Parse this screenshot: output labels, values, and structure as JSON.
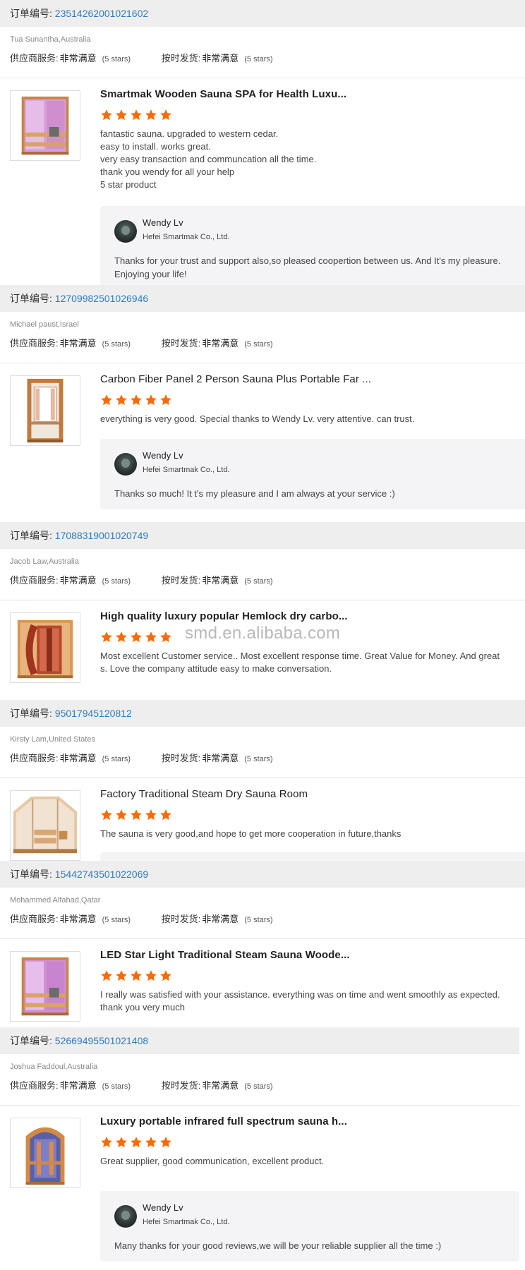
{
  "labels": {
    "order_no": "订单编号:",
    "supplier_service": "供应商服务:",
    "on_time_delivery": "按时发货:",
    "rating_value": "非常满意",
    "rating_stars": "(5 stars)"
  },
  "star_color": "#ff6a00",
  "link_color": "#2e7cc0",
  "orders": [
    {
      "order_number": "23514262001021602",
      "buyer": "Tua Sunantha,Australia",
      "product_title": "Smartmak Wooden Sauna SPA for Health Luxu...",
      "rating": 5,
      "review_lines": [
        "fantastic sauna. upgraded to western cedar.",
        "easy to install. works great.",
        "very easy transaction and communcation all the time.",
        "thank you wendy for all your help",
        "5 star product"
      ],
      "reply": {
        "name": "Wendy Lv",
        "company": "Hefei Smartmak Co., Ltd.",
        "lines": [
          "Thanks for your trust and support also,so pleased coopertion between us. And It's my pleasure.",
          "Enjoying your life!"
        ]
      }
    },
    {
      "order_number": "12709982501026946",
      "buyer": "Michael paust,Israel",
      "product_title": "Carbon Fiber Panel 2 Person Sauna Plus Portable Far ...",
      "rating": 5,
      "review_lines": [
        "everything is very good.  Special thanks to Wendy Lv.  very attentive.  can trust."
      ],
      "reply": {
        "name": "Wendy Lv",
        "company": "Hefei Smartmak Co., Ltd.",
        "lines": [
          "Thanks so much! It t's my pleasure and I am always at your service :)"
        ]
      }
    },
    {
      "order_number": "17088319001020749",
      "buyer": "Jacob Law,Australia",
      "product_title": "High quality luxury popular Hemlock dry carbo...",
      "rating": 5,
      "review_lines": [
        "Most excellent Customer service.. Most excellent response time. Great Value for Money. And great",
        "s. Love the company attitude easy to make conversation."
      ]
    },
    {
      "order_number": "95017945120812",
      "buyer": "Kirsty Lam,United States",
      "product_title": "Factory Traditional Steam Dry Sauna Room",
      "rating": 5,
      "review_lines": [
        "The sauna is very good,and hope to get more cooperation in future,thanks"
      ]
    },
    {
      "order_number": "15442743501022069",
      "buyer": "Mohammed Alfahad,Qatar",
      "product_title": "LED Star Light Traditional Steam Sauna Woode...",
      "rating": 5,
      "review_lines": [
        "I really was satisfied with your assistance. everything was on time and went smoothly as expected.",
        "thank you very much"
      ]
    },
    {
      "order_number": "52669495501021408",
      "buyer": "Joshua Faddoul,Australia",
      "product_title": "Luxury portable infrared full spectrum sauna h...",
      "rating": 5,
      "review_lines": [
        "Great supplier, good communication, excellent product."
      ],
      "reply": {
        "name": "Wendy Lv",
        "company": "Hefei Smartmak Co., Ltd.",
        "lines": [
          "Many thanks for your good reviews,we will be your reliable supplier all the time :)"
        ]
      }
    }
  ],
  "watermark": "smd.en.alibaba.com"
}
